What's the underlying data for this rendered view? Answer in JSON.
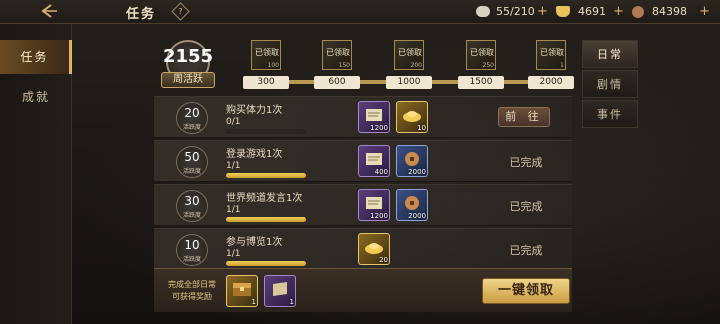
{
  "header": {
    "title": "任务",
    "help_glyph": "?",
    "resources": [
      {
        "icon": "stamina-icon",
        "value": "55/210",
        "color": "#d9cfbe"
      },
      {
        "icon": "gold-ingot-icon",
        "value": "4691",
        "color": "#e6c35a"
      },
      {
        "icon": "copper-coin-icon",
        "value": "84398",
        "color": "#b07a52"
      }
    ]
  },
  "leftnav": {
    "tabs": [
      {
        "label": "任务",
        "active": true
      },
      {
        "label": "成就",
        "active": false
      }
    ]
  },
  "activity": {
    "points": "2155",
    "label": "周活跃",
    "milestones": [
      {
        "threshold": "300",
        "status": "已领取",
        "qty": "100"
      },
      {
        "threshold": "600",
        "status": "已领取",
        "qty": "150"
      },
      {
        "threshold": "1000",
        "status": "已领取",
        "qty": "200"
      },
      {
        "threshold": "1500",
        "status": "已领取",
        "qty": "250"
      },
      {
        "threshold": "2000",
        "status": "已领取",
        "qty": "1"
      }
    ]
  },
  "righttabs": [
    {
      "label": "日常",
      "active": true
    },
    {
      "label": "剧情",
      "active": false
    },
    {
      "label": "事件",
      "active": false
    }
  ],
  "tasks": [
    {
      "points": "20",
      "points_label": "活跃度",
      "name": "购买体力1次",
      "progress": "0/1",
      "progress_value": 0,
      "rewards": [
        {
          "icon": "scroll-icon",
          "qty": "1200",
          "rarity": "purple"
        },
        {
          "icon": "gold-ingot-icon",
          "qty": "10",
          "rarity": "gold"
        }
      ],
      "action": "前 往",
      "completed": false
    },
    {
      "points": "50",
      "points_label": "活跃度",
      "name": "登录游戏1次",
      "progress": "1/1",
      "progress_value": 1,
      "rewards": [
        {
          "icon": "scroll-icon",
          "qty": "400",
          "rarity": "purple"
        },
        {
          "icon": "copper-coin-icon",
          "qty": "2000",
          "rarity": "blue"
        }
      ],
      "action": "已完成",
      "completed": true
    },
    {
      "points": "30",
      "points_label": "活跃度",
      "name": "世界频道发言1次",
      "progress": "1/1",
      "progress_value": 1,
      "rewards": [
        {
          "icon": "scroll-icon",
          "qty": "1200",
          "rarity": "purple"
        },
        {
          "icon": "copper-coin-icon",
          "qty": "2000",
          "rarity": "blue"
        }
      ],
      "action": "已完成",
      "completed": true
    },
    {
      "points": "10",
      "points_label": "活跃度",
      "name": "参与博览1次",
      "progress": "1/1",
      "progress_value": 1,
      "rewards": [
        {
          "icon": "gold-ingot-icon",
          "qty": "20",
          "rarity": "gold"
        }
      ],
      "action": "已完成",
      "completed": true
    }
  ],
  "footer": {
    "line1": "完成全部日常",
    "line2": "可获得奖励",
    "rewards": [
      {
        "icon": "treasure-chest-icon",
        "qty": "1",
        "rarity": "gold"
      },
      {
        "icon": "scroll-icon",
        "qty": "1",
        "rarity": "purple"
      }
    ],
    "claim_all": "一键领取"
  }
}
